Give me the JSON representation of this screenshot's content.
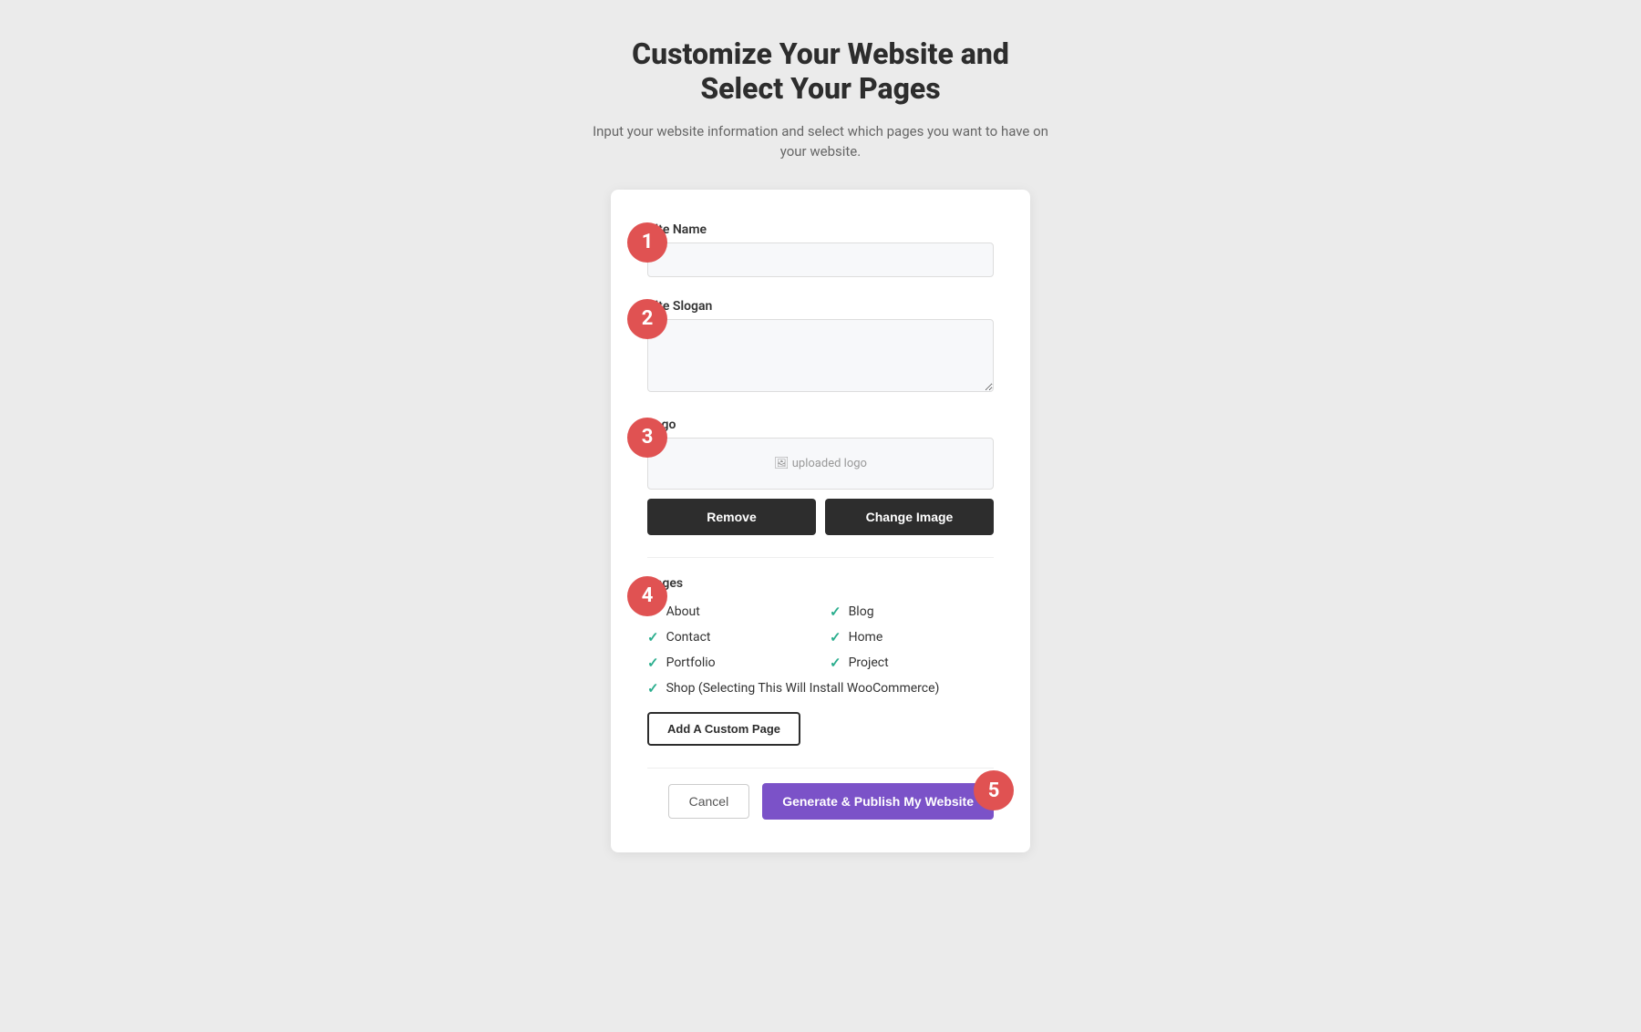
{
  "header": {
    "title_line1": "Customize Your Website and",
    "title_line2": "Select Your Pages",
    "subtitle": "Input your website information and select which pages you want to have on your website."
  },
  "steps": {
    "step1": "1",
    "step2": "2",
    "step3": "3",
    "step4": "4",
    "step5": "5"
  },
  "form": {
    "site_name_label": "Site Name",
    "site_name_placeholder": "",
    "site_slogan_label": "Site Slogan",
    "site_slogan_placeholder": "",
    "logo_label": "Logo",
    "logo_preview_text": "uploaded logo",
    "remove_button": "Remove",
    "change_image_button": "Change Image",
    "pages_label": "Pages",
    "pages": [
      {
        "label": "About",
        "checked": true
      },
      {
        "label": "Blog",
        "checked": true
      },
      {
        "label": "Contact",
        "checked": true
      },
      {
        "label": "Home",
        "checked": true
      },
      {
        "label": "Portfolio",
        "checked": true
      },
      {
        "label": "Project",
        "checked": true
      }
    ],
    "shop_label": "Shop (Selecting This Will Install WooCommerce)",
    "shop_checked": true,
    "add_custom_page_button": "Add A Custom Page",
    "cancel_button": "Cancel",
    "publish_button": "Generate & Publish My Website"
  }
}
